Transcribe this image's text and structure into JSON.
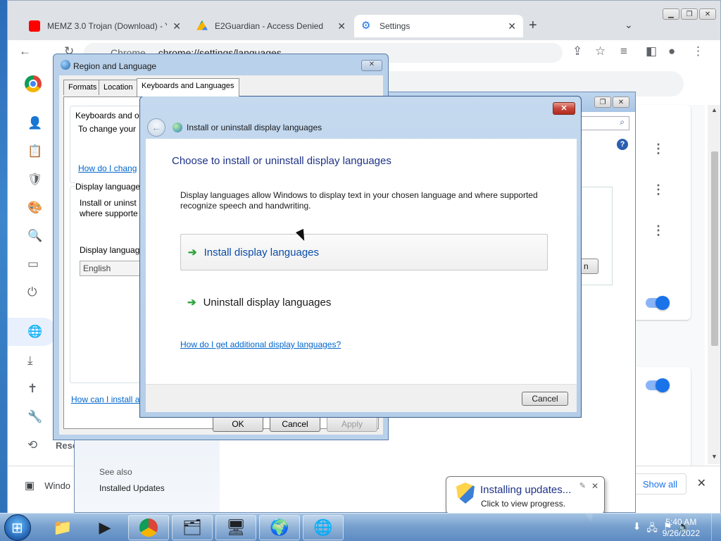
{
  "browser": {
    "tabs": [
      {
        "title": "MEMZ 3.0 Trojan (Download) - Yo",
        "icon": "youtube-icon",
        "color": "#ff0000",
        "active": false
      },
      {
        "title": "E2Guardian - Access Denied",
        "icon": "google-drive-icon",
        "color": "#f4b400",
        "active": false
      },
      {
        "title": "Settings",
        "icon": "gear-icon",
        "color": "#1a73e8",
        "active": true
      }
    ],
    "omnibox_chip": "Chrome",
    "url": "chrome://settings/languages",
    "nav_icons": [
      "person-icon",
      "clipboard-icon",
      "shield-icon",
      "palette-icon",
      "search-icon",
      "browser-icon",
      "power-icon",
      "globe-icon",
      "download-icon",
      "accessibility-icon",
      "wrench-icon",
      "history-icon"
    ],
    "nav_partial_text": "Rese",
    "bottom_bar": {
      "item_label": "Windo",
      "show_all": "Show all"
    },
    "accent": "#1a73e8"
  },
  "control_panel": {
    "see_also": "See also",
    "installed_updates": "Installed Updates",
    "button_fragment": "n"
  },
  "region_dialog": {
    "title": "Region and Language",
    "tabs": [
      "Formats",
      "Location",
      "Keyboards and Languages"
    ],
    "group1_title": "Keyboards and o",
    "group1_text": "To change your",
    "group1_link": "How do I chang",
    "group2_title": "Display language",
    "group2_line1": "Install or uninst",
    "group2_line2": "where supporte",
    "display_label": "Display languag",
    "display_value": "English",
    "bottom_link": "How can I install a",
    "ok": "OK",
    "cancel": "Cancel",
    "apply": "Apply"
  },
  "wizard": {
    "title": "Install or uninstall display languages",
    "heading": "Choose to install or uninstall display languages",
    "description": "Display languages allow Windows to display text in your chosen language and where supported recognize speech and handwriting.",
    "option_install": "Install display languages",
    "option_uninstall": "Uninstall display languages",
    "link": "How do I get additional display languages?",
    "cancel": "Cancel"
  },
  "balloon": {
    "title": "Installing updates...",
    "subtitle": "Click to view progress."
  },
  "taskbar": {
    "time": "5:40 AM",
    "date": "9/26/2022",
    "apps": [
      "explorer-icon",
      "media-player-icon",
      "chrome-icon",
      "control-panel-icon",
      "system-icon",
      "globe-settings-icon",
      "region-language-icon"
    ]
  }
}
